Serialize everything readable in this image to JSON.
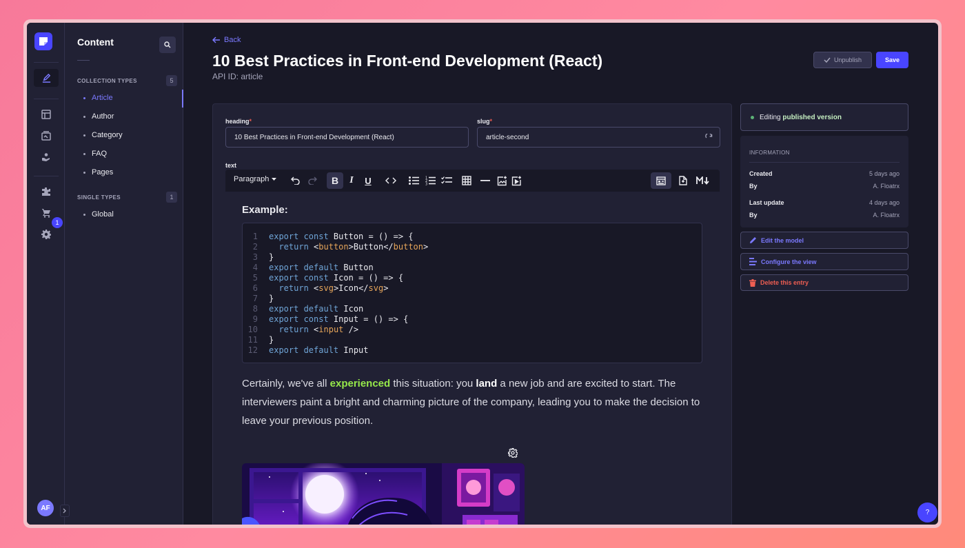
{
  "sidebar": {
    "avatar_initials": "AF",
    "notification_count": "1",
    "icons": [
      "content-manager-icon",
      "content-types-builder-icon",
      "media-library-icon",
      "releases-icon",
      "plugins-icon",
      "marketplace-icon",
      "settings-icon"
    ]
  },
  "subnav": {
    "title": "Content",
    "collection_types_label": "COLLECTION TYPES",
    "collection_types_count": "5",
    "collection_items": [
      "Article",
      "Author",
      "Category",
      "FAQ",
      "Pages"
    ],
    "single_types_label": "SINGLE TYPES",
    "single_types_count": "1",
    "single_items": [
      "Global"
    ]
  },
  "header": {
    "back_label": "Back",
    "title": "10 Best Practices in Front-end Development (React)",
    "api_id": "API ID: article",
    "unpublish_label": "Unpublish",
    "save_label": "Save"
  },
  "fields": {
    "heading_label": "heading",
    "heading_value": "10 Best Practices in Front-end Development (React)",
    "slug_label": "slug",
    "slug_value": "article-second",
    "text_label": "text",
    "required_mark": "*"
  },
  "toolbar": {
    "paragraph_label": "Paragraph"
  },
  "editor": {
    "example_heading": "Example:",
    "code_lines": [
      {
        "n": "1",
        "parts": [
          [
            "kw",
            "export const "
          ],
          [
            "tx",
            "Button = () => {"
          ]
        ]
      },
      {
        "n": "2",
        "parts": [
          [
            "tx",
            "  "
          ],
          [
            "kw",
            "return "
          ],
          [
            "tx",
            "<"
          ],
          [
            "tg",
            "button"
          ],
          [
            "tx",
            ">Button</"
          ],
          [
            "tg",
            "button"
          ],
          [
            "tx",
            ">"
          ]
        ]
      },
      {
        "n": "3",
        "parts": [
          [
            "tx",
            "}"
          ]
        ]
      },
      {
        "n": "4",
        "parts": [
          [
            "kw",
            "export default "
          ],
          [
            "tx",
            "Button"
          ]
        ]
      },
      {
        "n": "5",
        "parts": [
          [
            "kw",
            "export const "
          ],
          [
            "tx",
            "Icon = () => {"
          ]
        ]
      },
      {
        "n": "6",
        "parts": [
          [
            "tx",
            "  "
          ],
          [
            "kw",
            "return "
          ],
          [
            "tx",
            "<"
          ],
          [
            "tg",
            "svg"
          ],
          [
            "tx",
            ">Icon</"
          ],
          [
            "tg",
            "svg"
          ],
          [
            "tx",
            ">"
          ]
        ]
      },
      {
        "n": "7",
        "parts": [
          [
            "tx",
            "}"
          ]
        ]
      },
      {
        "n": "8",
        "parts": [
          [
            "kw",
            "export default "
          ],
          [
            "tx",
            "Icon"
          ]
        ]
      },
      {
        "n": "9",
        "parts": [
          [
            "kw",
            "export const "
          ],
          [
            "tx",
            "Input = () => {"
          ]
        ]
      },
      {
        "n": "10",
        "parts": [
          [
            "tx",
            "  "
          ],
          [
            "kw",
            "return "
          ],
          [
            "tx",
            "<"
          ],
          [
            "tg",
            "input"
          ],
          [
            "tx",
            " />"
          ]
        ]
      },
      {
        "n": "11",
        "parts": [
          [
            "tx",
            "}"
          ]
        ]
      },
      {
        "n": "12",
        "parts": [
          [
            "kw",
            "export default "
          ],
          [
            "tx",
            "Input"
          ]
        ]
      }
    ],
    "paragraph": {
      "p1": "Certainly, we've all ",
      "highlight": "experienced",
      "p2": " this situation: you ",
      "bold": "land",
      "p3": " a new job and are excited to start. The interviewers paint a bright and charming picture of the company, leading you to make the decision to leave your previous position."
    }
  },
  "side": {
    "status_prefix": "Editing",
    "status_accent": "published version",
    "info_title": "INFORMATION",
    "created_label": "Created",
    "created_value": "5 days ago",
    "by_label_1": "By",
    "by_value_1": "A. Floatrx",
    "updated_label": "Last update",
    "updated_value": "4 days ago",
    "by_label_2": "By",
    "by_value_2": "A. Floatrx",
    "edit_model_label": "Edit the model",
    "configure_view_label": "Configure the view",
    "delete_label": "Delete this entry"
  },
  "help_label": "?",
  "colors": {
    "accent": "#4945ff",
    "accent_light": "#7b79ff",
    "danger": "#ee5e52",
    "success": "#5cb176",
    "highlight": "#96e84a"
  }
}
